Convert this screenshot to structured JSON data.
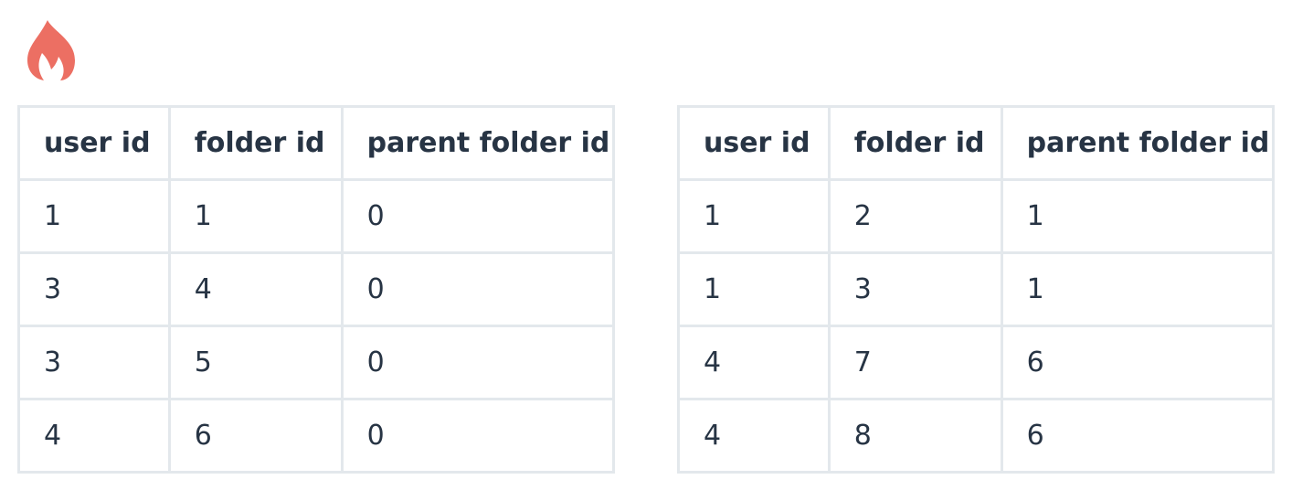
{
  "icon": {
    "name": "flame-icon",
    "color": "#ec6f63"
  },
  "tables": [
    {
      "headers": [
        "user id",
        "folder id",
        "parent folder id"
      ],
      "rows": [
        [
          "1",
          "1",
          "0"
        ],
        [
          "3",
          "4",
          "0"
        ],
        [
          "3",
          "5",
          "0"
        ],
        [
          "4",
          "6",
          "0"
        ]
      ]
    },
    {
      "headers": [
        "user id",
        "folder id",
        "parent folder id"
      ],
      "rows": [
        [
          "1",
          "2",
          "1"
        ],
        [
          "1",
          "3",
          "1"
        ],
        [
          "4",
          "7",
          "6"
        ],
        [
          "4",
          "8",
          "6"
        ]
      ]
    }
  ],
  "colors": {
    "text": "#273444",
    "outer_border": "#c5ced6",
    "inner_border": "#e3e8ec"
  }
}
